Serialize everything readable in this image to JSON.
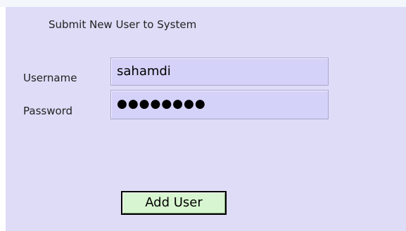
{
  "form": {
    "title": "Submit New User to System",
    "username_label": "Username",
    "username_value": "sahamdi",
    "password_label": "Password",
    "password_value": "●●●●●●●●",
    "submit_label": "Add User"
  },
  "colors": {
    "panel_background": "#dedcf7",
    "field_background": "#d4d2f8",
    "button_background": "#d7f5d0"
  }
}
